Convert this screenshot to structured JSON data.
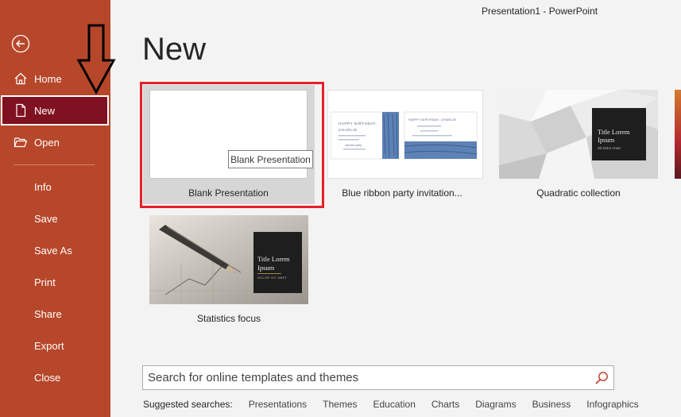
{
  "window": {
    "title": "Presentation1  -  PowerPoint"
  },
  "sidebar": {
    "items": [
      {
        "label": "Home",
        "icon": "home-icon"
      },
      {
        "label": "New",
        "icon": "new-document-icon",
        "selected": true
      },
      {
        "label": "Open",
        "icon": "folder-open-icon"
      },
      {
        "label": "Info"
      },
      {
        "label": "Save"
      },
      {
        "label": "Save As"
      },
      {
        "label": "Print"
      },
      {
        "label": "Share"
      },
      {
        "label": "Export"
      },
      {
        "label": "Close"
      }
    ],
    "accent": "#b7472a",
    "selected_bg": "#7f1120"
  },
  "main": {
    "title": "New",
    "templates": [
      {
        "label": "Blank Presentation",
        "tooltip": "Blank Presentation",
        "highlighted": true
      },
      {
        "label": "Blue ribbon party invitation...",
        "preview_left": {
          "line1": "HAPPY BIRTHDAY,",
          "line2": "CHARLIE",
          "line3": "Join the party",
          "line4": ""
        },
        "preview_right": {
          "line1": "HAPPY BIRTHDAY, CHARLIE"
        }
      },
      {
        "label": "Quadratic collection",
        "preview_title": "Title Lorem Ipsum",
        "preview_sub": "Sit Dolor Amet"
      },
      {
        "label": "Statistics focus",
        "preview_title": "Title Lorem Ipsum",
        "preview_sub": "DOLOR SIT AMET"
      }
    ],
    "highlight_color": "#e5202a"
  },
  "search": {
    "placeholder": "Search for online templates and themes",
    "value": "",
    "suggested_label": "Suggested searches:",
    "suggestions": [
      "Presentations",
      "Themes",
      "Education",
      "Charts",
      "Diagrams",
      "Business",
      "Infographics"
    ]
  }
}
